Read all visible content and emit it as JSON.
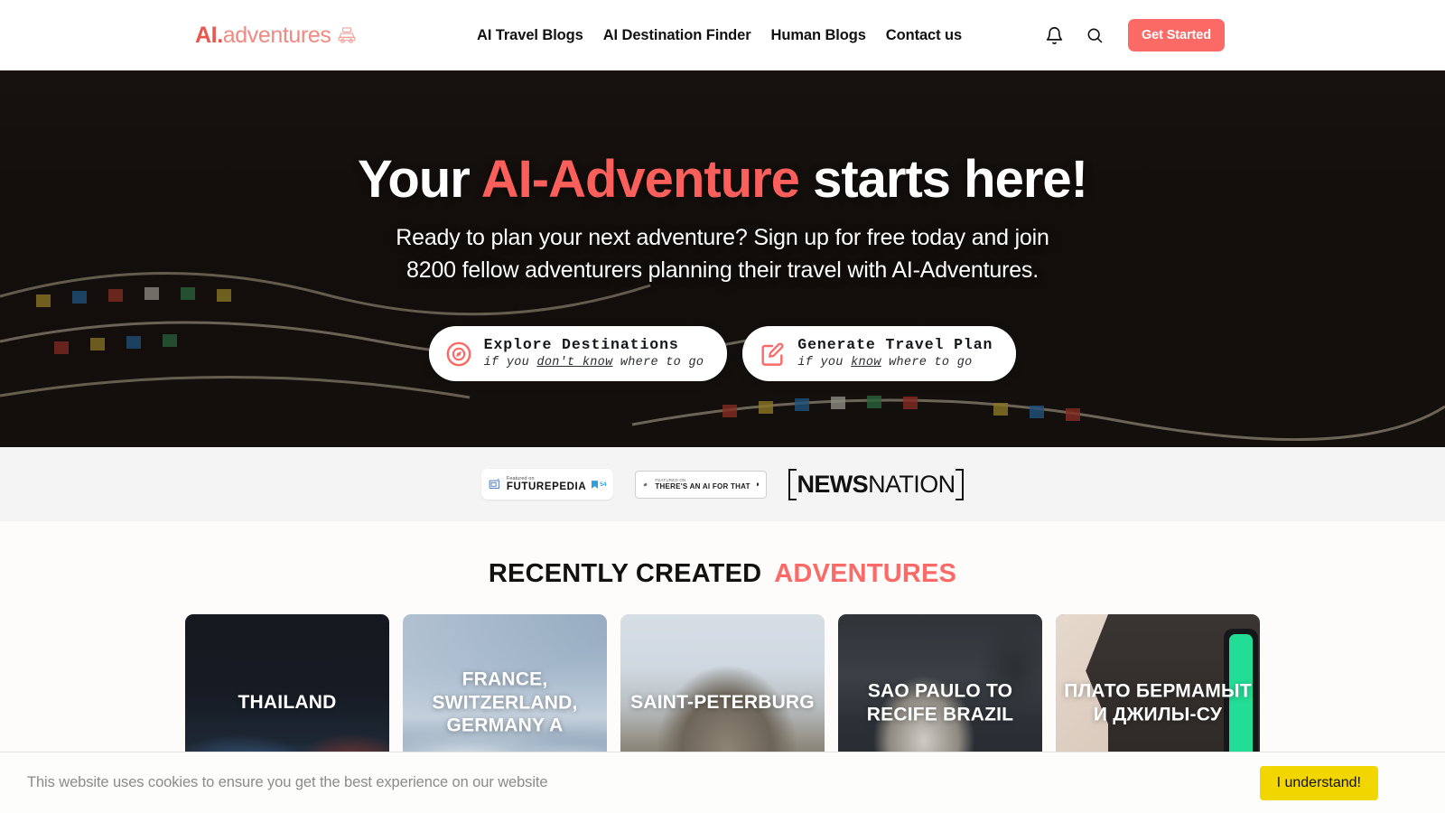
{
  "brand": {
    "logo_ai": "AI.",
    "logo_rest": "adventures",
    "car_icon": "car-icon"
  },
  "nav": {
    "items": [
      {
        "label": "AI Travel Blogs"
      },
      {
        "label": "AI Destination Finder"
      },
      {
        "label": "Human Blogs"
      },
      {
        "label": "Contact us"
      }
    ],
    "bell_icon": "bell-icon",
    "search_icon": "search-icon",
    "cta_label": "Get Started"
  },
  "hero": {
    "title_before": "Your ",
    "title_accent": "AI-Adventure",
    "title_after": " starts here!",
    "subtitle_line1": "Ready to plan your next adventure? Sign up for free today and join",
    "subtitle_line2": "8200 fellow adventurers planning their travel with AI-Adventures.",
    "ctas": [
      {
        "icon": "compass-icon",
        "title": "Explore Destinations",
        "sub_before": "if you ",
        "sub_underline": "don't know",
        "sub_after": " where to go"
      },
      {
        "icon": "edit-note-icon",
        "title": "Generate Travel Plan",
        "sub_before": "if you ",
        "sub_underline": "know",
        "sub_after": " where to go"
      }
    ]
  },
  "press": {
    "futurepedia": {
      "featured_label": "Featured on",
      "name": "FUTUREPEDIA",
      "count": "54",
      "icon": "futurepedia-icon"
    },
    "taaft": {
      "featured_label": "FEATURED ON",
      "name": "THERE'S AN AI FOR THAT",
      "icon": "taaft-icon",
      "bookmark_icon": "bookmark-icon"
    },
    "newsnation": {
      "bold": "NEWS",
      "light": "NATION"
    }
  },
  "recent": {
    "heading_dark": "RECENTLY CREATED",
    "heading_accent": "ADVENTURES",
    "cards": [
      {
        "title": "THAILAND"
      },
      {
        "title": "FRANCE, SWITZERLAND, GERMANY A"
      },
      {
        "title": "SAINT-PETERBURG"
      },
      {
        "title": "SAO PAULO TO RECIFE BRAZIL"
      },
      {
        "title": "ПЛАТО БЕРМАМЫТ И ДЖИЛЫ-СУ"
      }
    ]
  },
  "cookie": {
    "message": "This website uses cookies to ensure you get the best experience on our website",
    "accept_label": "I understand!"
  },
  "colors": {
    "accent": "#fb6a66",
    "cta_button": "#fc6a66",
    "cookie_button": "#f2d600",
    "card_green": "#22dd95"
  }
}
